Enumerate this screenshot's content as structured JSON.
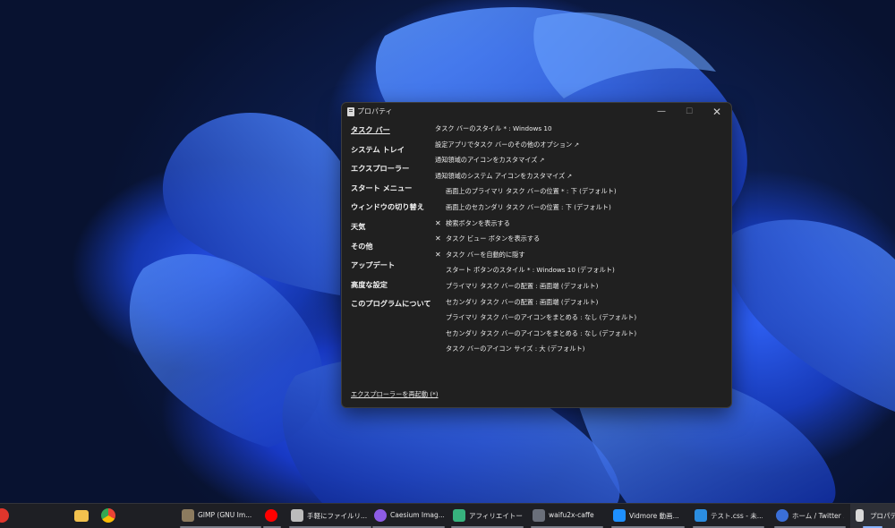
{
  "window": {
    "title": "プロパティ",
    "controls": {
      "minimize": "—",
      "maximize": "☐",
      "close": "✕"
    }
  },
  "nav": [
    {
      "label": "タスク バー",
      "active": true
    },
    {
      "label": "システム トレイ"
    },
    {
      "label": "エクスプローラー"
    },
    {
      "label": "スタート メニュー"
    },
    {
      "label": "ウィンドウの切り替え"
    },
    {
      "label": "天気"
    },
    {
      "label": "その他"
    },
    {
      "label": "アップデート"
    },
    {
      "label": "高度な設定"
    },
    {
      "label": "このプログラムについて"
    }
  ],
  "options": [
    {
      "text": "タスク バーのスタイル * : Windows 10"
    },
    {
      "text": "設定アプリでタスク バーのその他のオプション",
      "link": "↗"
    },
    {
      "text": "通知領域のアイコンをカスタマイズ",
      "link": "↗"
    },
    {
      "text": "通知領域のシステム アイコンをカスタマイズ",
      "link": "↗"
    },
    {
      "text": "画面上のプライマリ タスク バーの位置 * : 下 (デフォルト)",
      "indent": true
    },
    {
      "text": "画面上のセカンダリ タスク バーの位置 : 下 (デフォルト)",
      "indent": true
    },
    {
      "text": "検索ボタンを表示する",
      "check": "✕"
    },
    {
      "text": "タスク ビュー ボタンを表示する",
      "check": "✕"
    },
    {
      "text": "タスク バーを自動的に隠す",
      "check": "✕"
    },
    {
      "text": "スタート ボタンのスタイル * : Windows 10 (デフォルト)",
      "indent": true
    },
    {
      "text": "プライマリ タスク バーの配置 : 画面端 (デフォルト)",
      "indent": true
    },
    {
      "text": "セカンダリ タスク バーの配置 : 画面端 (デフォルト)",
      "indent": true
    },
    {
      "text": "プライマリ タスク バーのアイコンをまとめる : なし (デフォルト)",
      "indent": true
    },
    {
      "text": "セカンダリ タスク バーのアイコンをまとめる : なし (デフォルト)",
      "indent": true
    },
    {
      "text": "タスク バーのアイコン サイズ : 大 (デフォルト)",
      "indent": true
    }
  ],
  "restart_link": "エクスプローラーを再起動 (*)",
  "taskbar": {
    "pinned_icons": [
      {
        "name": "vivaldi-icon",
        "color": "#e0362c"
      },
      {
        "name": "file-explorer-icon",
        "color": "#f2c14e"
      },
      {
        "name": "chrome-icon",
        "color": "#4285f4"
      }
    ],
    "items": [
      {
        "label": "GIMP (GNU Im...",
        "icon": "gimp-icon",
        "color": "#8c7b5f"
      },
      {
        "label": "",
        "icon": "youtube-music-icon",
        "color": "#ff0000"
      },
      {
        "label": "手軽にファイルリ...",
        "icon": "hourglass-icon",
        "color": "#bcbcbc"
      },
      {
        "label": "Caesium Imag...",
        "icon": "caesium-icon",
        "color": "#8e5ce6"
      },
      {
        "label": "アフィリエイトー...",
        "icon": "layers-icon",
        "color": "#37b37e"
      },
      {
        "label": "waifu2x-caffe",
        "icon": "waifu2x-icon",
        "color": "#6a6f7a"
      },
      {
        "label": "Vidmore 動画...",
        "icon": "vidmore-icon",
        "color": "#1e90ff"
      },
      {
        "label": "テスト.css - 未...",
        "icon": "vscode-icon",
        "color": "#2b8de0"
      },
      {
        "label": "ホーム / Twitter ...",
        "icon": "edge-icon",
        "color": "#3a6fd8"
      },
      {
        "label": "プロパティ",
        "icon": "properties-icon",
        "color": "#d9d9d9",
        "active": true
      }
    ]
  }
}
